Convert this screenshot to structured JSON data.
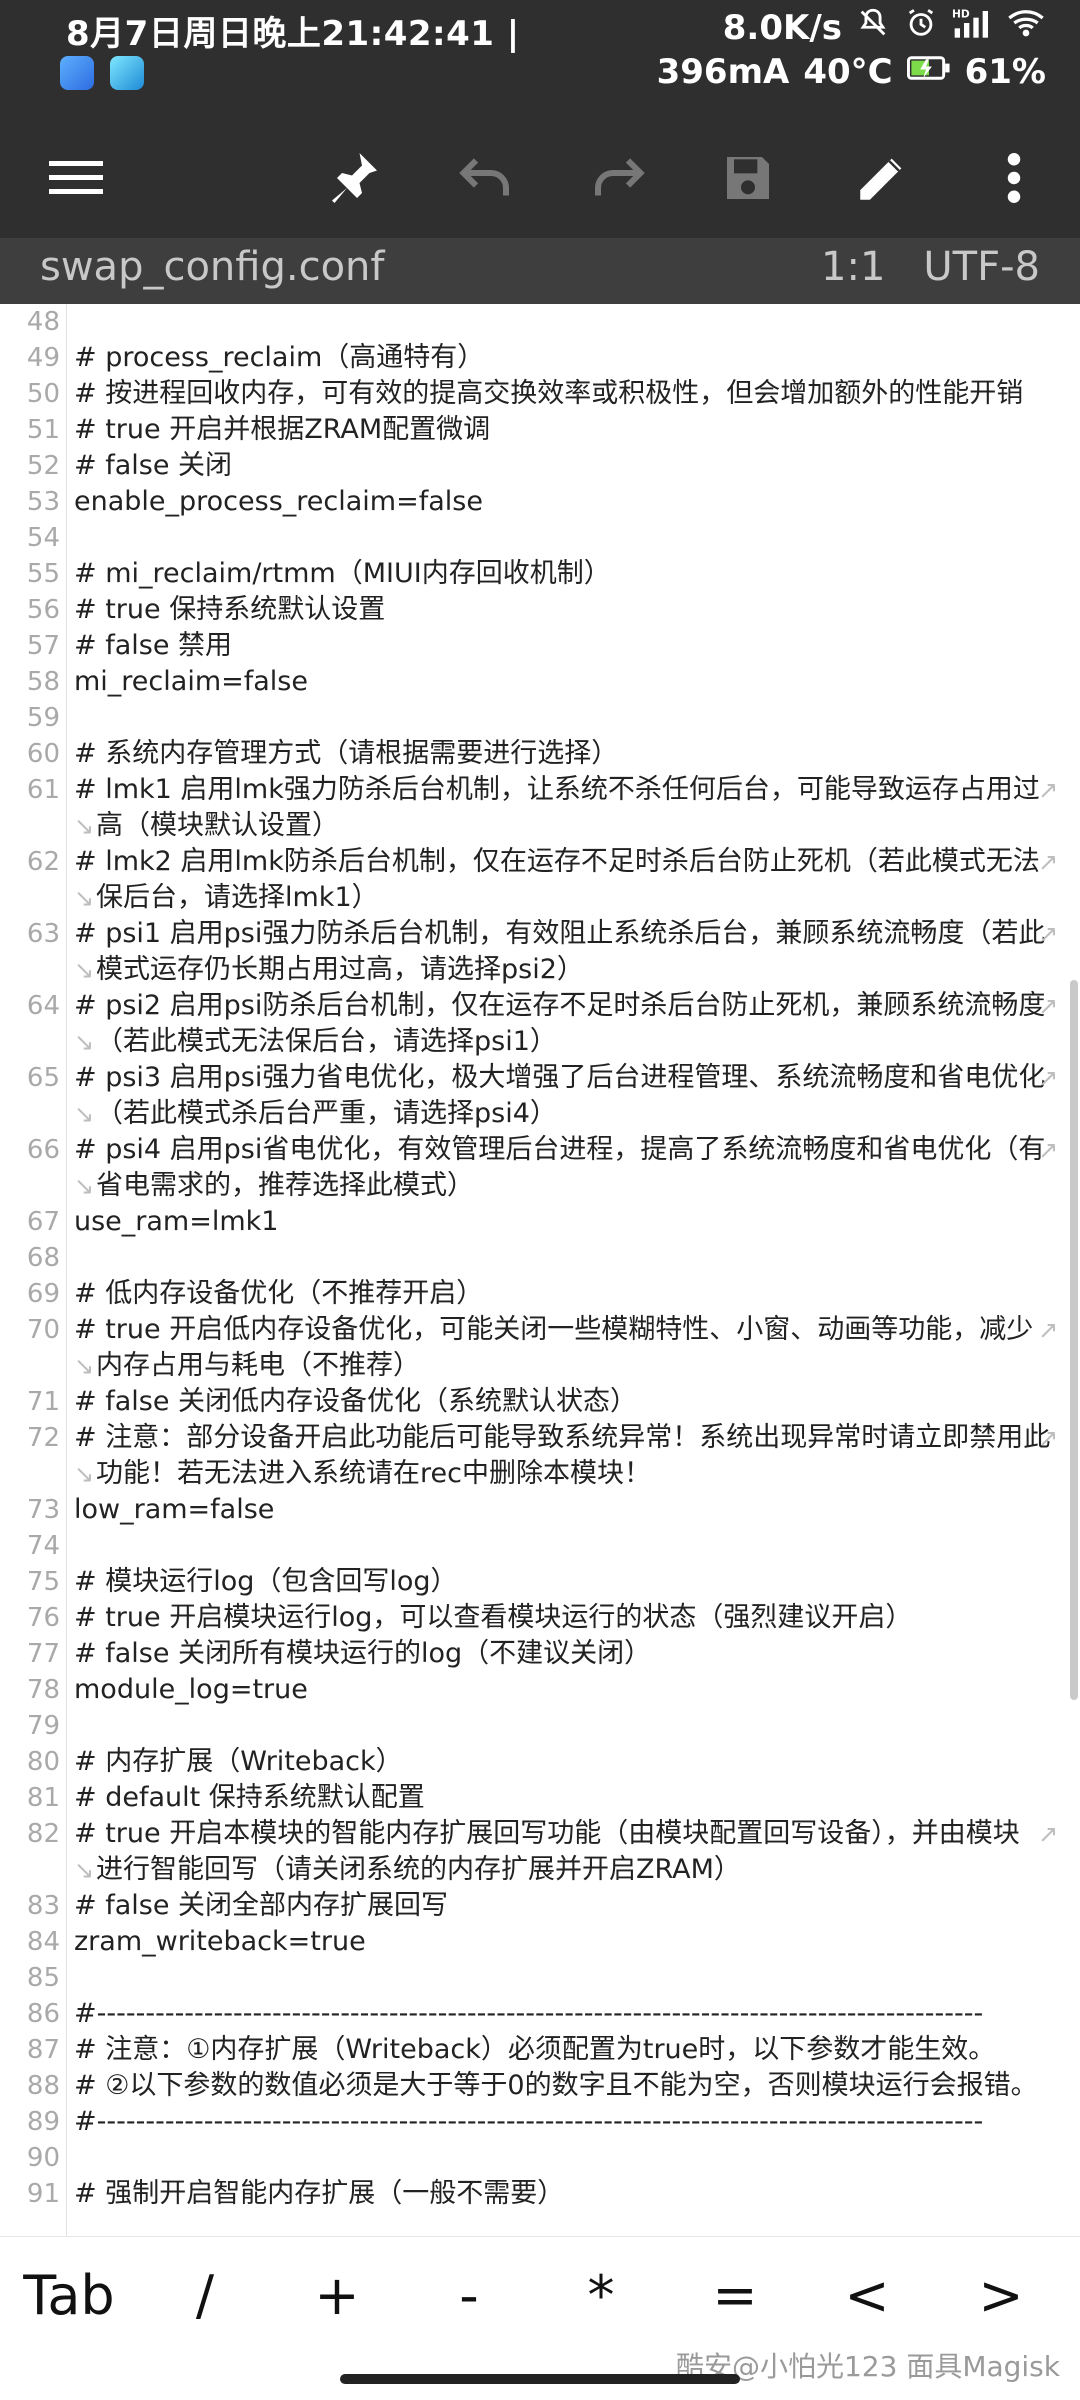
{
  "status_bar": {
    "datetime": "8月7日周日晚上21:42:41",
    "net_speed": "8.0K/s",
    "signal_label": "HD",
    "current": "396mA",
    "temperature": "40°C",
    "battery": "61%"
  },
  "toolbar": {
    "icons": [
      "menu-icon",
      "pin-icon",
      "undo-icon",
      "redo-icon",
      "save-icon",
      "edit-icon",
      "more-icon"
    ]
  },
  "file": {
    "name": "swap_config.conf",
    "position": "1:1",
    "encoding": "UTF-8"
  },
  "editor": {
    "lines": [
      {
        "n": "48",
        "t": ""
      },
      {
        "n": "49",
        "t": "#  process_reclaim（高通特有）"
      },
      {
        "n": "50",
        "t": "#  按进程回收内存，可有效的提高交换效率或积极性，但会增加额外的性能开销"
      },
      {
        "n": "51",
        "t": "#  true  开启并根据ZRAM配置微调"
      },
      {
        "n": "52",
        "t": "#  false  关闭"
      },
      {
        "n": "53",
        "t": "enable_process_reclaim=false"
      },
      {
        "n": "54",
        "t": ""
      },
      {
        "n": "55",
        "t": "#  mi_reclaim/rtmm（MIUI内存回收机制）"
      },
      {
        "n": "56",
        "t": "#  true  保持系统默认设置"
      },
      {
        "n": "57",
        "t": "#  false  禁用"
      },
      {
        "n": "58",
        "t": "mi_reclaim=false"
      },
      {
        "n": "59",
        "t": ""
      },
      {
        "n": "60",
        "t": "#  系统内存管理方式（请根据需要进行选择）"
      },
      {
        "n": "61",
        "t": "#  lmk1  启用lmk强力防杀后台机制，让系统不杀任何后台，可能导致运存占用过"
      },
      {
        "n": "",
        "t": "高（模块默认设置）"
      },
      {
        "n": "62",
        "t": "#  lmk2  启用lmk防杀后台机制，仅在运存不足时杀后台防止死机（若此模式无法"
      },
      {
        "n": "",
        "t": "保后台，请选择lmk1）"
      },
      {
        "n": "63",
        "t": "#  psi1  启用psi强力防杀后台机制，有效阻止系统杀后台，兼顾系统流畅度（若此"
      },
      {
        "n": "",
        "t": "模式运存仍长期占用过高，请选择psi2）"
      },
      {
        "n": "64",
        "t": "#  psi2  启用psi防杀后台机制，仅在运存不足时杀后台防止死机，兼顾系统流畅度"
      },
      {
        "n": "",
        "t": "（若此模式无法保后台，请选择psi1）"
      },
      {
        "n": "65",
        "t": "#  psi3  启用psi强力省电优化，极大增强了后台进程管理、系统流畅度和省电优化"
      },
      {
        "n": "",
        "t": "（若此模式杀后台严重，请选择psi4）"
      },
      {
        "n": "66",
        "t": "#  psi4  启用psi省电优化，有效管理后台进程，提高了系统流畅度和省电优化（有"
      },
      {
        "n": "",
        "t": "省电需求的，推荐选择此模式）"
      },
      {
        "n": "67",
        "t": "use_ram=lmk1"
      },
      {
        "n": "68",
        "t": ""
      },
      {
        "n": "69",
        "t": "#  低内存设备优化（不推荐开启）"
      },
      {
        "n": "70",
        "t": "#  true  开启低内存设备优化，可能关闭一些模糊特性、小窗、动画等功能，减少"
      },
      {
        "n": "",
        "t": "内存占用与耗电（不推荐）"
      },
      {
        "n": "71",
        "t": "#  false  关闭低内存设备优化（系统默认状态）"
      },
      {
        "n": "72",
        "t": "#  注意：部分设备开启此功能后可能导致系统异常！系统出现异常时请立即禁用此"
      },
      {
        "n": "",
        "t": "功能！若无法进入系统请在rec中删除本模块！"
      },
      {
        "n": "73",
        "t": "low_ram=false"
      },
      {
        "n": "74",
        "t": ""
      },
      {
        "n": "75",
        "t": "#  模块运行log（包含回写log）"
      },
      {
        "n": "76",
        "t": "#  true  开启模块运行log，可以查看模块运行的状态（强烈建议开启）"
      },
      {
        "n": "77",
        "t": "#  false  关闭所有模块运行的log（不建议关闭）"
      },
      {
        "n": "78",
        "t": "module_log=true"
      },
      {
        "n": "79",
        "t": ""
      },
      {
        "n": "80",
        "t": "#  内存扩展（Writeback）"
      },
      {
        "n": "81",
        "t": "#  default  保持系统默认配置"
      },
      {
        "n": "82",
        "t": "#  true  开启本模块的智能内存扩展回写功能（由模块配置回写设备），并由模块"
      },
      {
        "n": "",
        "t": "进行智能回写（请关闭系统的内存扩展并开启ZRAM）"
      },
      {
        "n": "83",
        "t": "#  false  关闭全部内存扩展回写"
      },
      {
        "n": "84",
        "t": "zram_writeback=true"
      },
      {
        "n": "85",
        "t": ""
      },
      {
        "n": "86",
        "t": "#-------------------------------------------------------------------------------------------"
      },
      {
        "n": "87",
        "t": "#  注意：①内存扩展（Writeback）必须配置为true时，以下参数才能生效。"
      },
      {
        "n": "88",
        "t": "#  ②以下参数的数值必须是大于等于0的数字且不能为空，否则模块运行会报错。"
      },
      {
        "n": "89",
        "t": "#-------------------------------------------------------------------------------------------"
      },
      {
        "n": "90",
        "t": ""
      },
      {
        "n": "91",
        "t": "#  强制开启智能内存扩展（一般不需要）"
      }
    ]
  },
  "keys": [
    "Tab",
    "/",
    "+",
    "-",
    "*",
    "=",
    "<",
    ">"
  ],
  "watermark": "酷安@小怕光123  面具Magisk"
}
